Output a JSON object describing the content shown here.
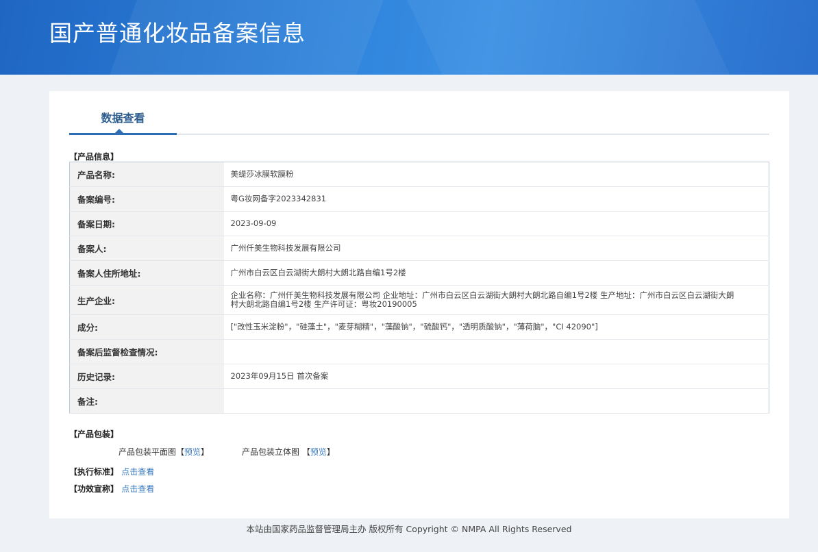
{
  "header": {
    "title": "国产普通化妆品备案信息"
  },
  "tab": {
    "label": "数据查看"
  },
  "product_info": {
    "section_label": "【产品信息】",
    "rows": [
      {
        "label": "产品名称:",
        "value": "美缇莎冰膜软膜粉"
      },
      {
        "label": "备案编号:",
        "value": "粤G妆网备字2023342831"
      },
      {
        "label": "备案日期:",
        "value": "2023-09-09"
      },
      {
        "label": "备案人:",
        "value": "广州仟美生物科技发展有限公司"
      },
      {
        "label": "备案人住所地址:",
        "value": "广州市白云区白云湖街大朗村大朗北路自编1号2楼"
      },
      {
        "label": "生产企业:",
        "value": "企业名称：广州仟美生物科技发展有限公司 企业地址：广州市白云区白云湖街大朗村大朗北路自编1号2楼 生产地址：广州市白云区白云湖街大朗村大朗北路自编1号2楼 生产许可证：粤妆20190005"
      },
      {
        "label": "成分:",
        "value": "[\"改性玉米淀粉\"，\"硅藻土\"，\"麦芽糊精\"，\"藻酸钠\"，\"硫酸钙\"，\"透明质酸钠\"，\"薄荷脑\"，\"CI 42090\"]"
      },
      {
        "label": "备案后监督检查情况:",
        "value": ""
      },
      {
        "label": "历史记录:",
        "value": "2023年09月15日 首次备案"
      },
      {
        "label": "备注:",
        "value": ""
      }
    ]
  },
  "packaging": {
    "section_label": "【产品包装】",
    "flat_label": "产品包装平面图",
    "stereo_label": "产品包装立体图",
    "bracket_open": "【",
    "bracket_close": "】",
    "preview_link": "预览"
  },
  "standard": {
    "label": "【执行标准】",
    "link": "点击查看"
  },
  "efficacy": {
    "label": "【功效宣称】",
    "link": "点击查看"
  },
  "footer": {
    "text": "本站由国家药品监督管理局主办 版权所有 Copyright © NMPA All Rights Reserved"
  }
}
